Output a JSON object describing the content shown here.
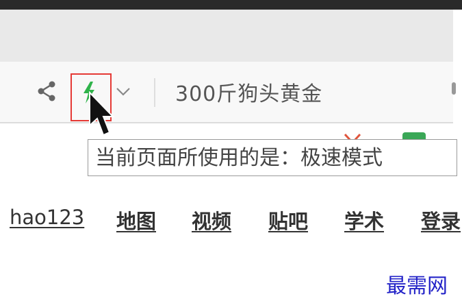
{
  "toolbar": {
    "share_icon": "share-icon",
    "mode_icon": "lightning-icon",
    "mode_icon_color": "#2fb34a",
    "dropdown_icon": "chevron-down-icon",
    "search_text": "300斤狗头黄金"
  },
  "tooltip": {
    "text": "当前页面所使用的是：极速模式"
  },
  "nav": {
    "items": [
      "hao123",
      "地图",
      "视频",
      "贴吧",
      "学术",
      "登录"
    ]
  },
  "watermark": {
    "text": "最需网"
  },
  "colors": {
    "highlight_border": "#e53935",
    "watermark": "#2323c8"
  }
}
